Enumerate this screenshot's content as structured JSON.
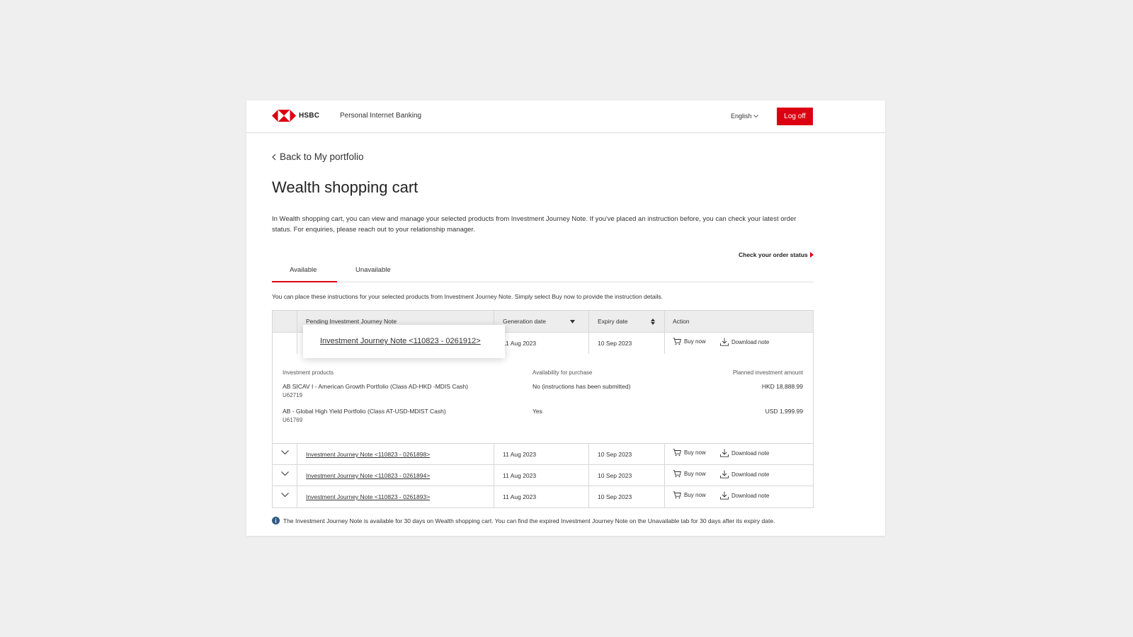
{
  "header": {
    "brand": "HSBC",
    "app_name": "Personal Internet Banking",
    "language": "English",
    "logoff_label": "Log off",
    "brand_color": "#db0011"
  },
  "back_link": "Back to My portfolio",
  "page_title": "Wealth shopping cart",
  "intro": "In Wealth shopping cart, you can view and manage your selected products from Investment Journey Note. If you've placed an instruction before, you can check your latest order status. For enquiries, please reach out to your relationship manager.",
  "order_status_link": "Check your order status",
  "tabs": [
    {
      "label": "Available",
      "active": true
    },
    {
      "label": "Unavailable",
      "active": false
    }
  ],
  "instruction_text": "You can place these instructions for your selected products from Investment Journey Note. Simply select Buy now to provide the instruction details.",
  "table": {
    "headers": {
      "note": "Pending Investment Journey Note",
      "generation": "Generation date",
      "expiry": "Expiry date",
      "action": "Action"
    },
    "rows": [
      {
        "note": "Investment Journey Note <110823 - 0261912>",
        "generation": "11 Aug 2023",
        "expiry": "10 Sep 2023",
        "buy": "Buy now",
        "download": "Download note",
        "expanded": true
      },
      {
        "note": "Investment Journey Note <110823 - 0261898>",
        "generation": "11 Aug 2023",
        "expiry": "10 Sep 2023",
        "buy": "Buy now",
        "download": "Download note",
        "expanded": false
      },
      {
        "note": "Investment Journey Note <110823 - 0261894>",
        "generation": "11 Aug 2023",
        "expiry": "10 Sep 2023",
        "buy": "Buy now",
        "download": "Download note",
        "expanded": false
      },
      {
        "note": "Investment Journey Note <110823 - 0261893>",
        "generation": "11 Aug 2023",
        "expiry": "10 Sep 2023",
        "buy": "Buy now",
        "download": "Download note",
        "expanded": false
      }
    ],
    "expanded": {
      "headers": {
        "product": "Investment products",
        "availability": "Availability for purchase",
        "amount": "Planned investment amount"
      },
      "products": [
        {
          "name": "AB SICAV I - American Growth Portfolio (Class AD-HKD -MDIS Cash)",
          "code": "U62719",
          "availability": "No (instructions has been submitted)",
          "amount": "HKD 18,888.99"
        },
        {
          "name": "AB - Global High Yield Portfolio (Class AT-USD-MDIST Cash)",
          "code": "U61769",
          "availability": "Yes",
          "amount": "USD 1,999.99"
        }
      ]
    }
  },
  "footer_note": "The Investment Journey Note is available for 30 days on Wealth shopping cart. You can find the expired Investment Journey Note on the Unavailable tab for 30 days after its expiry date."
}
